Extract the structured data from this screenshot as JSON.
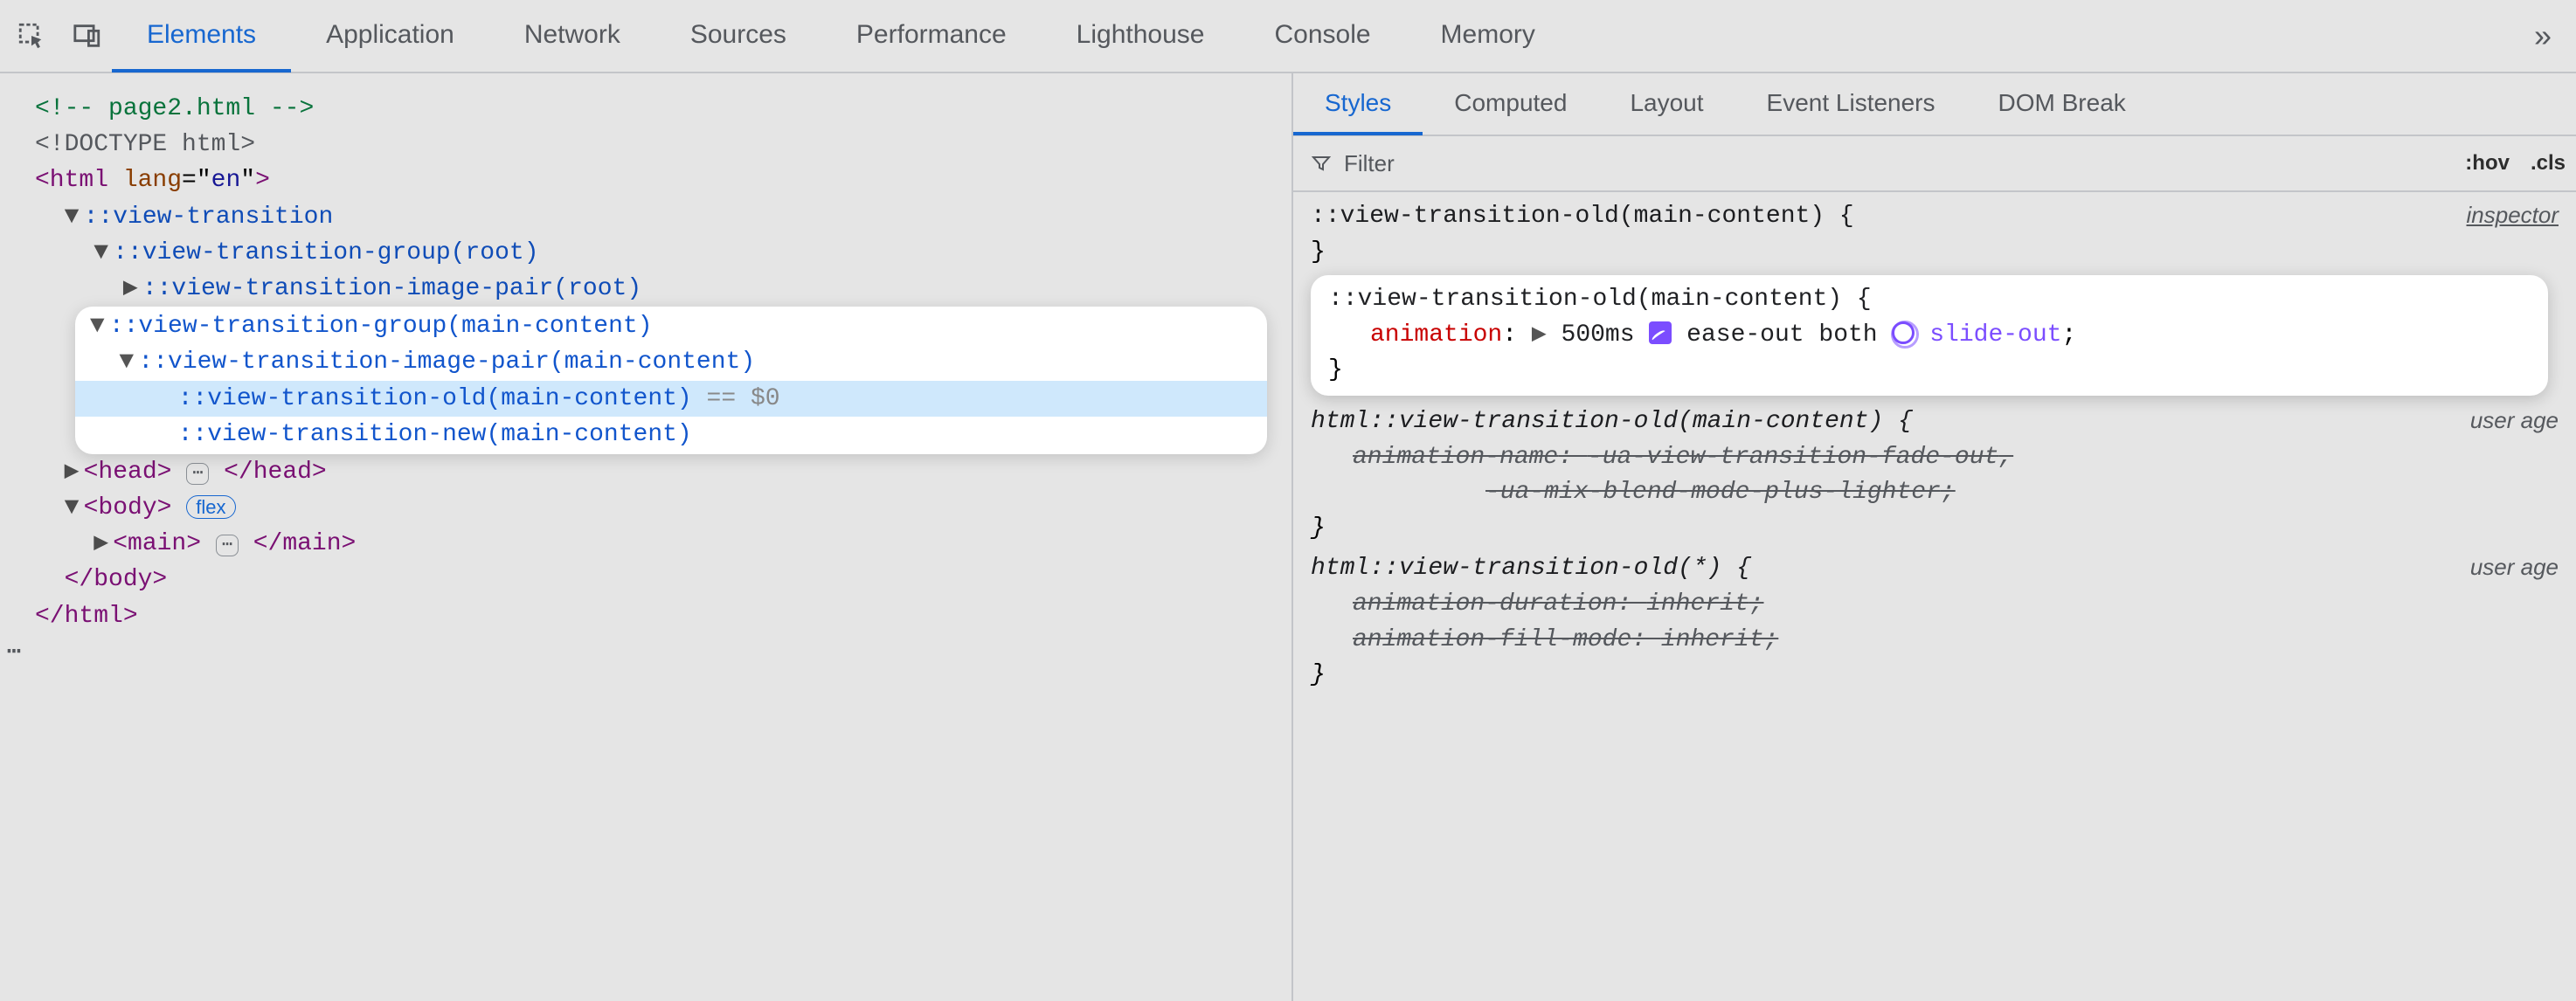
{
  "tabs": [
    "Elements",
    "Application",
    "Network",
    "Sources",
    "Performance",
    "Lighthouse",
    "Console",
    "Memory"
  ],
  "activeTab": "Elements",
  "dom": {
    "comment": "<!-- page2.html -->",
    "doctype": "<!DOCTYPE html>",
    "htmlOpen": {
      "tag": "html",
      "attr": "lang",
      "val": "en"
    },
    "vt": "::view-transition",
    "vtGroupRoot": "::view-transition-group(root)",
    "vtImagePairRoot": "::view-transition-image-pair(root)",
    "vtGroupMain": "::view-transition-group(main-content)",
    "vtImagePairMain": "::view-transition-image-pair(main-content)",
    "vtOldMain": "::view-transition-old(main-content)",
    "vtNewMain": "::view-transition-new(main-content)",
    "dollar": "== $0",
    "headTag": "head",
    "bodyTag": "body",
    "bodyBadge": "flex",
    "mainTag": "main",
    "ellipsis": "⋯"
  },
  "styles": {
    "subtabs": [
      "Styles",
      "Computed",
      "Layout",
      "Event Listeners",
      "DOM Break"
    ],
    "activeSubtab": "Styles",
    "filterPlaceholder": "Filter",
    "hov": ":hov",
    "cls": ".cls",
    "rule0": {
      "selector": "::view-transition-old(main-content) {",
      "close": "}",
      "origin": "inspector"
    },
    "rule1": {
      "selector": "::view-transition-old(main-content) {",
      "prop": "animation",
      "duration": "500ms",
      "timing": "ease-out",
      "fill": "both",
      "name": "slide-out",
      "close": "}"
    },
    "rule2": {
      "selector": "html::view-transition-old(main-content) {",
      "origin": "user age",
      "prop": "animation-name",
      "val1": "-ua-view-transition-fade-out",
      "val2": "-ua-mix-blend-mode-plus-lighter",
      "close": "}"
    },
    "rule3": {
      "selector": "html::view-transition-old(*) {",
      "origin": "user age",
      "p1": "animation-duration",
      "v1": "inherit",
      "p2": "animation-fill-mode",
      "v2": "inherit",
      "close": "}"
    }
  }
}
